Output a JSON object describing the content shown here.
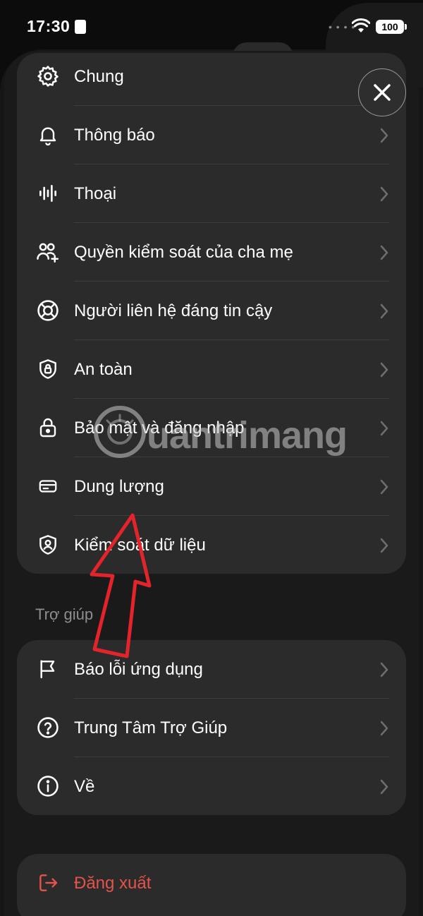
{
  "status_bar": {
    "time": "17:30",
    "battery": "100"
  },
  "main_items": [
    {
      "label": "Chung",
      "icon": "gear-icon"
    },
    {
      "label": "Thông báo",
      "icon": "bell-icon"
    },
    {
      "label": "Thoại",
      "icon": "voice-waveform-icon"
    },
    {
      "label": "Quyền kiểm soát của cha mẹ",
      "icon": "parental-users-icon"
    },
    {
      "label": "Người liên hệ đáng tin cậy",
      "icon": "lifebuoy-icon"
    },
    {
      "label": "An toàn",
      "icon": "shield-lock-icon"
    },
    {
      "label": "Bảo mật và đăng nhập",
      "icon": "padlock-icon"
    },
    {
      "label": "Dung lượng",
      "icon": "storage-icon"
    },
    {
      "label": "Kiểm soát dữ liệu",
      "icon": "shield-user-icon"
    }
  ],
  "help_section": {
    "title": "Trợ giúp",
    "items": [
      {
        "label": "Báo lỗi ứng dụng",
        "icon": "flag-icon"
      },
      {
        "label": "Trung Tâm Trợ Giúp",
        "icon": "question-circle-icon"
      },
      {
        "label": "Về",
        "icon": "info-circle-icon"
      }
    ]
  },
  "logout": {
    "label": "Đăng xuất",
    "icon": "logout-icon",
    "color": "#e5534b"
  },
  "watermark": {
    "text": "uantrimang"
  },
  "colors": {
    "card_background": "#2b2b2b",
    "page_background": "#1a1a1a",
    "annotation_arrow": "#e3242b"
  }
}
